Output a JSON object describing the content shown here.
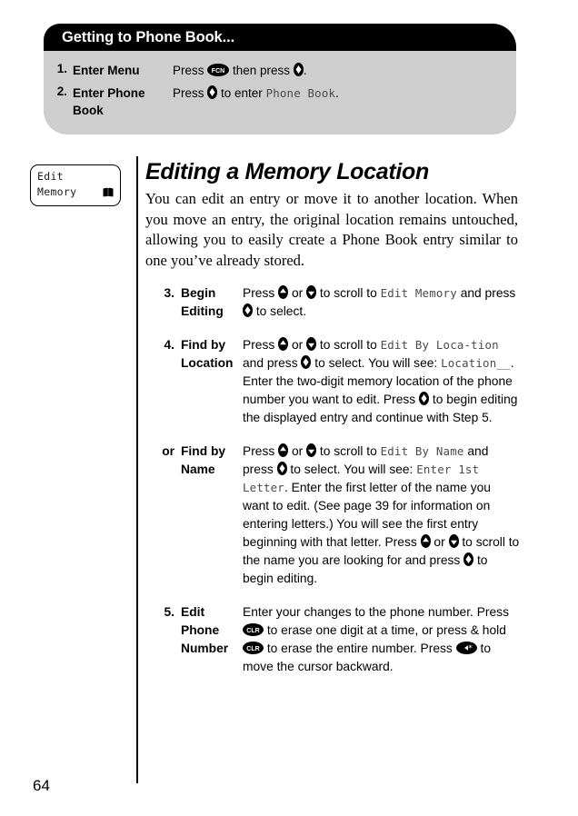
{
  "callout": {
    "title": "Getting to Phone Book...",
    "rows": [
      {
        "num": "1.",
        "label": "Enter Menu",
        "desc_pre": "Press ",
        "desc_mid": " then press ",
        "desc_post": "."
      },
      {
        "num": "2.",
        "label": "Enter Phone Book",
        "desc_pre": "Press ",
        "desc_mid": " to enter ",
        "lcd": "Phone Book",
        "desc_post": "."
      }
    ]
  },
  "lcd_chip": {
    "line1": "Edit",
    "line2": "Memory",
    "icon": "book-icon"
  },
  "heading": "Editing a Memory Location",
  "intro": "You can edit an entry or move it to another location. When you move an entry, the original location remains untouched, allowing you to easily create a Phone Book entry similar to one you’ve already stored.",
  "steps": [
    {
      "num": "3.",
      "label": "Begin Editing",
      "parts": [
        {
          "t": "text",
          "v": "Press "
        },
        {
          "t": "key",
          "v": "up-arrow-key"
        },
        {
          "t": "text",
          "v": " or "
        },
        {
          "t": "key",
          "v": "down-arrow-key"
        },
        {
          "t": "text",
          "v": " to scroll to "
        },
        {
          "t": "lcd",
          "v": "Edit Memory"
        },
        {
          "t": "text",
          "v": " and press "
        },
        {
          "t": "key",
          "v": "select-key"
        },
        {
          "t": "text",
          "v": " to select."
        }
      ]
    },
    {
      "num": "4.",
      "label": "Find by Location",
      "parts": [
        {
          "t": "text",
          "v": "Press "
        },
        {
          "t": "key",
          "v": "up-arrow-key"
        },
        {
          "t": "text",
          "v": " or "
        },
        {
          "t": "key",
          "v": "down-arrow-key"
        },
        {
          "t": "text",
          "v": " to scroll to "
        },
        {
          "t": "lcd",
          "v": "Edit By Loca-tion"
        },
        {
          "t": "text",
          "v": " and press "
        },
        {
          "t": "key",
          "v": "select-key"
        },
        {
          "t": "text",
          "v": " to select. You will see: "
        },
        {
          "t": "lcd",
          "v": "Location__"
        },
        {
          "t": "text",
          "v": ". Enter the two-digit memory location of the phone number you want to edit. Press "
        },
        {
          "t": "key",
          "v": "select-key"
        },
        {
          "t": "text",
          "v": " to begin editing the displayed entry and continue with Step 5."
        }
      ]
    },
    {
      "num": "or",
      "label": "Find by Name",
      "parts": [
        {
          "t": "text",
          "v": "Press "
        },
        {
          "t": "key",
          "v": "up-arrow-key"
        },
        {
          "t": "text",
          "v": " or "
        },
        {
          "t": "key",
          "v": "down-arrow-key"
        },
        {
          "t": "text",
          "v": " to scroll to "
        },
        {
          "t": "lcd",
          "v": "Edit By Name"
        },
        {
          "t": "text",
          "v": " and press "
        },
        {
          "t": "key",
          "v": "select-key"
        },
        {
          "t": "text",
          "v": " to select. You will see: "
        },
        {
          "t": "lcd",
          "v": "Enter 1st Letter"
        },
        {
          "t": "text",
          "v": ". Enter the first letter of the name you want to edit. (See page 39 for information on entering letters.) You will see the first entry beginning with that letter. Press "
        },
        {
          "t": "key",
          "v": "up-arrow-key"
        },
        {
          "t": "text",
          "v": " or "
        },
        {
          "t": "key",
          "v": "down-arrow-key"
        },
        {
          "t": "text",
          "v": " to scroll to the name you are looking for and press "
        },
        {
          "t": "key",
          "v": "select-key"
        },
        {
          "t": "text",
          "v": " to begin editing."
        }
      ]
    },
    {
      "num": "5.",
      "label": "Edit Phone Number",
      "parts": [
        {
          "t": "text",
          "v": "Enter your changes to the phone number. Press "
        },
        {
          "t": "key",
          "v": "clr-key"
        },
        {
          "t": "text",
          "v": " to erase one digit at a time, or press & hold "
        },
        {
          "t": "key",
          "v": "clr-key"
        },
        {
          "t": "text",
          "v": " to erase the entire number. Press "
        },
        {
          "t": "key",
          "v": "back-star-key"
        },
        {
          "t": "text",
          "v": " to move the cursor backward."
        }
      ]
    }
  ],
  "keys": {
    "fcn": "FCN",
    "clr": "CLR"
  },
  "page_number": "64",
  "colors": {
    "header_bg": "#000000",
    "panel_bg": "#cecece",
    "text": "#000000",
    "lcd_text": "#4a4a4a"
  }
}
